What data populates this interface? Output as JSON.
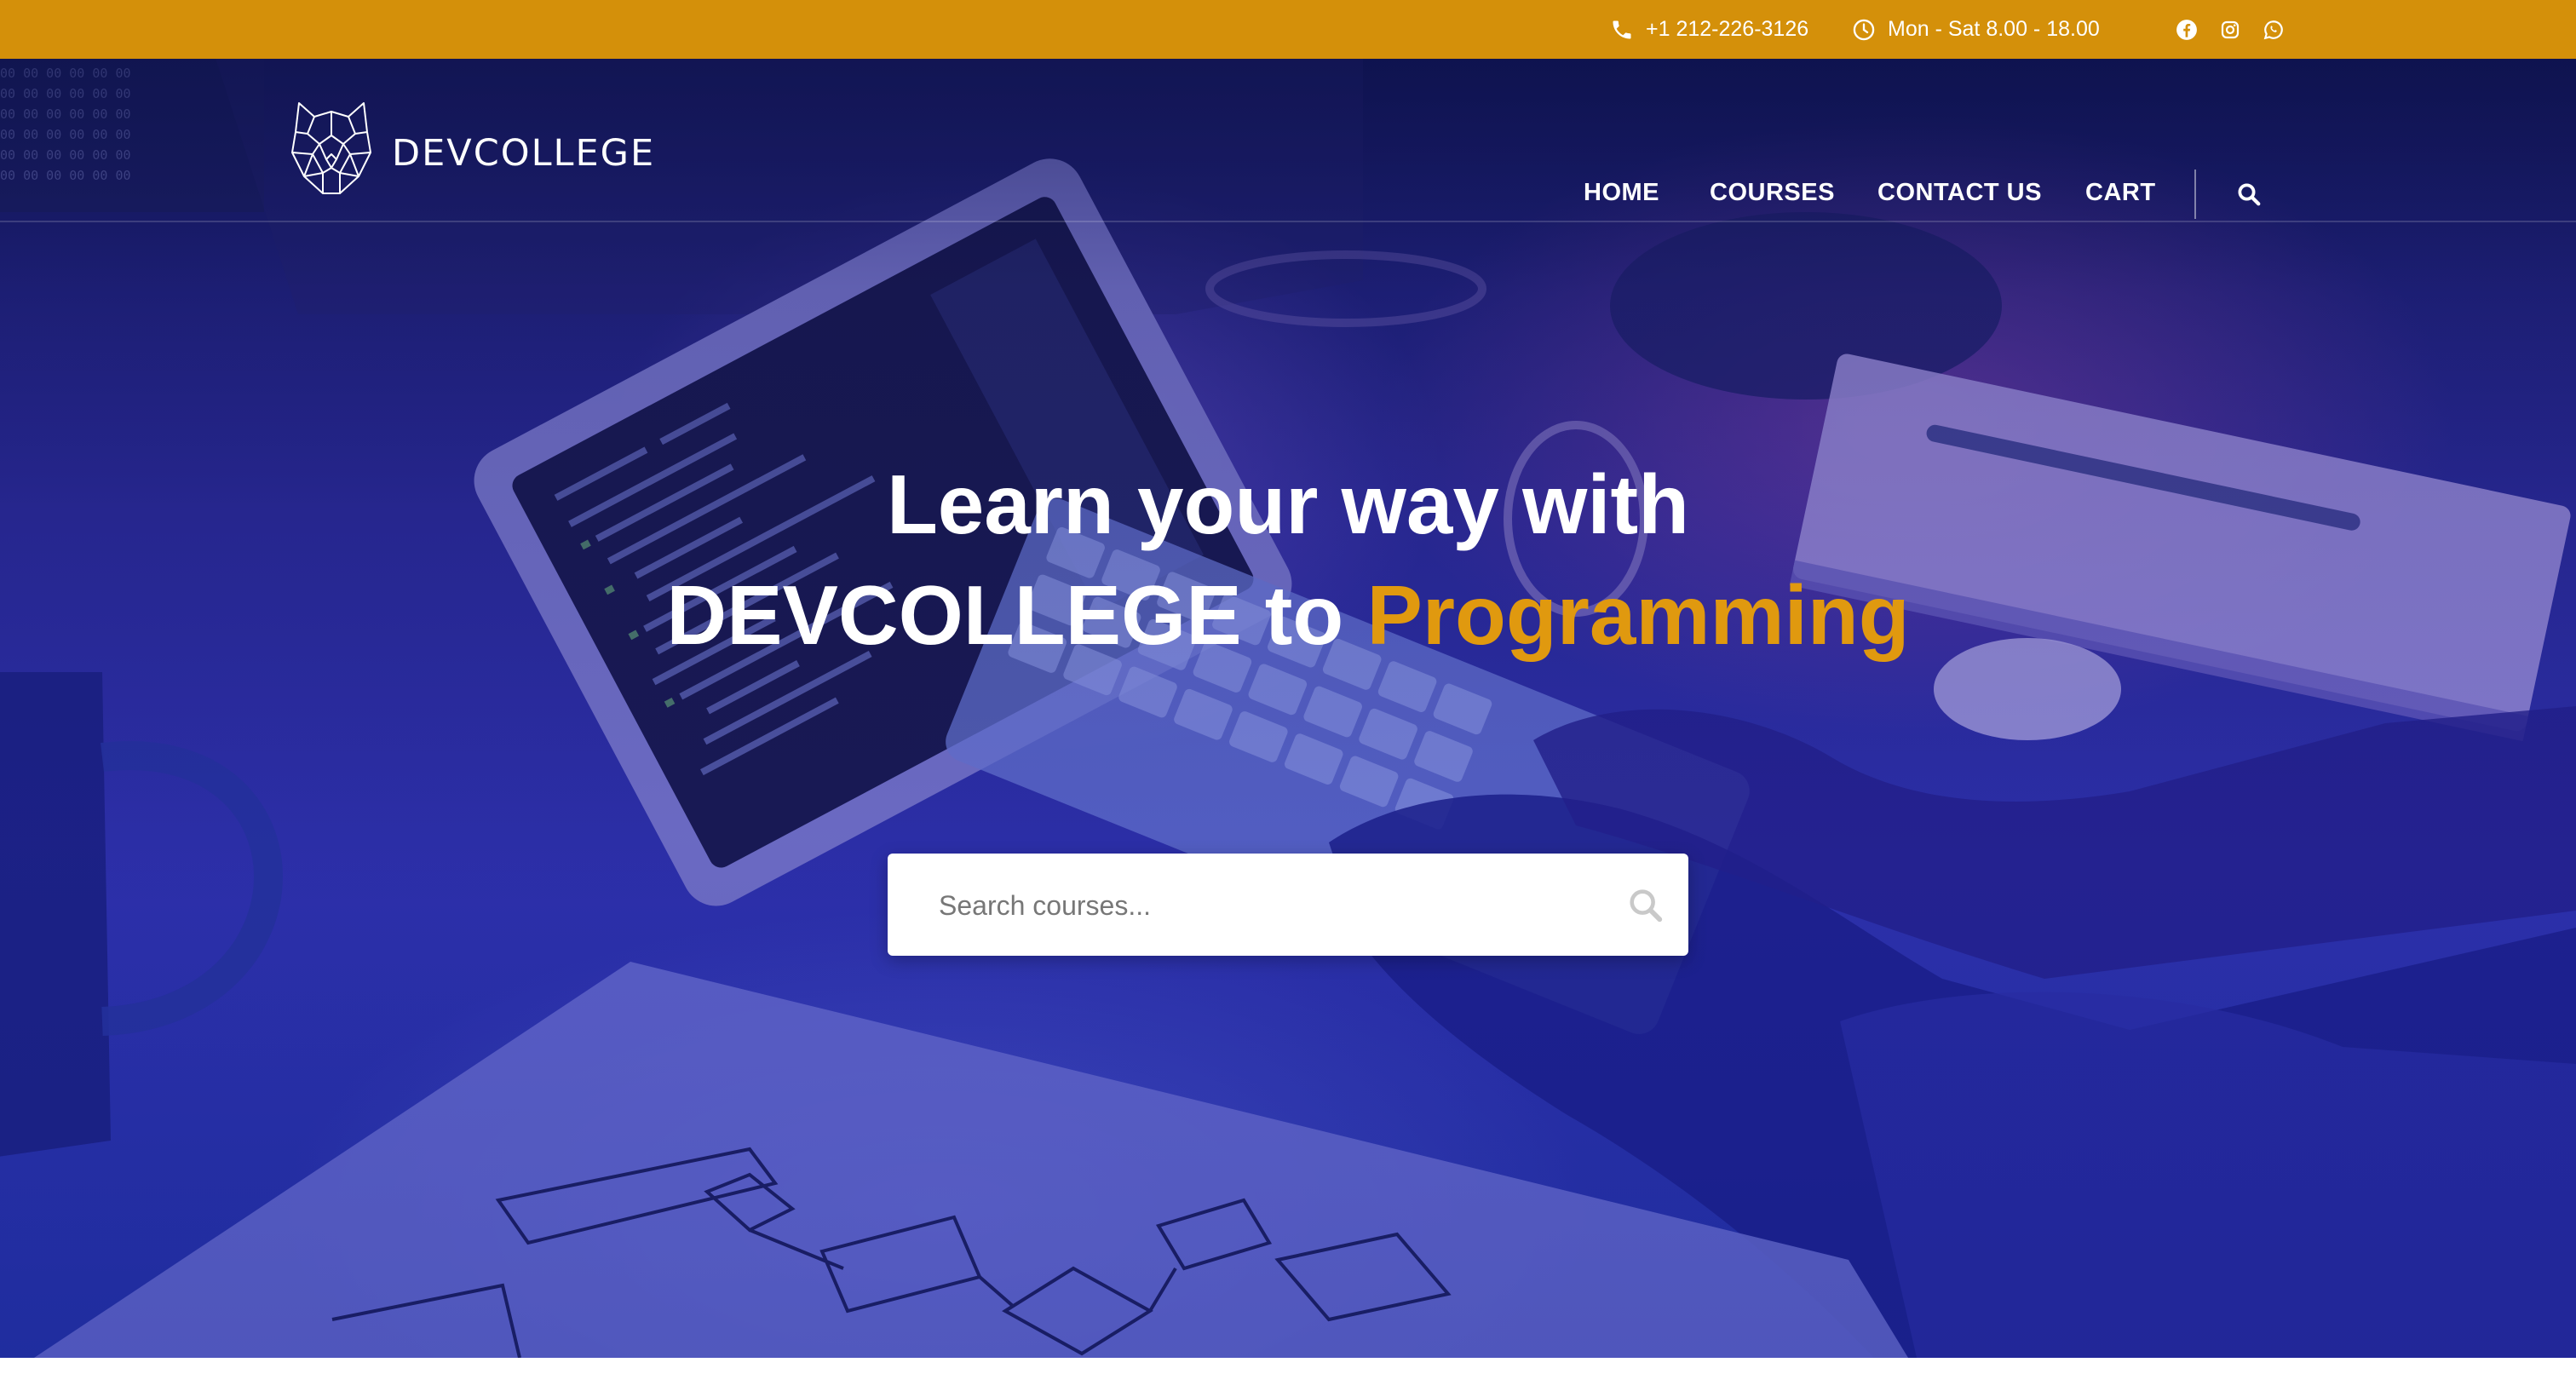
{
  "topbar": {
    "phone": "+1 212-226-3126",
    "hours": "Mon - Sat 8.00 - 18.00",
    "social": [
      "facebook-icon",
      "instagram-icon",
      "whatsapp-icon"
    ],
    "background": "#d4900a"
  },
  "header": {
    "brand": "DEVCOLLEGE",
    "nav": [
      "HOME",
      "COURSES",
      "CONTACT US",
      "CART"
    ]
  },
  "hero": {
    "line1": "Learn your way with",
    "line2_prefix": "DEVCOLLEGE to ",
    "line2_accent": "Programming",
    "accent_color": "#e0990f",
    "search": {
      "placeholder": "Search courses..."
    }
  }
}
